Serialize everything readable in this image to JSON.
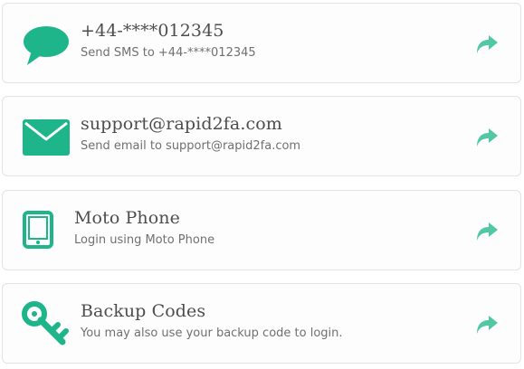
{
  "accent_color": "#1fb58a",
  "methods": [
    {
      "icon": "speech-bubble-icon",
      "title": "+44-****012345",
      "subtitle": "Send SMS to +44-****012345"
    },
    {
      "icon": "envelope-icon",
      "title": "support@rapid2fa.com",
      "subtitle": "Send email to support@rapid2fa.com"
    },
    {
      "icon": "tablet-icon",
      "title": "Moto Phone",
      "subtitle": "Login using Moto Phone"
    },
    {
      "icon": "key-icon",
      "title": "Backup Codes",
      "subtitle": "You may also use your backup code to login."
    }
  ],
  "action_icon": "share-arrow-icon"
}
